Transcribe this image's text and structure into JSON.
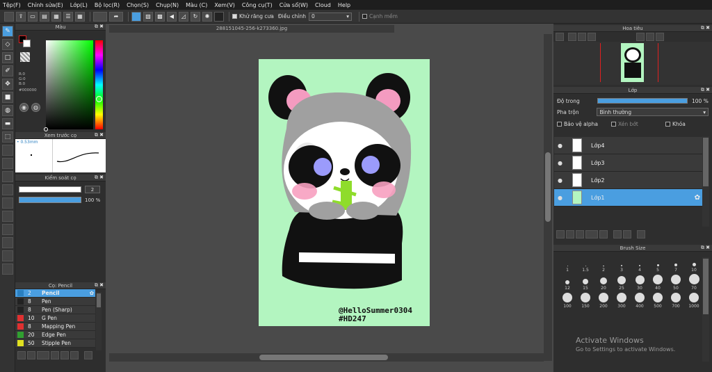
{
  "menu": [
    "Tệp(F)",
    "Chỉnh sửa(E)",
    "Lớp(L)",
    "Bộ lọc(R)",
    "Chọn(S)",
    "Chụp(N)",
    "Màu (C)",
    "Xem(V)",
    "Công cụ(T)",
    "Cửa sổ(W)",
    "Cloud",
    "Help"
  ],
  "toolbar": {
    "antialias_label": "Khử răng cưa",
    "correction_label": "Điều chỉnh",
    "correction_value": "0",
    "snap_label": "Cạnh mềm"
  },
  "color_panel": {
    "title": "Màu",
    "r": "R:0",
    "g": "G:0",
    "b": "B:0",
    "hex": "#000000",
    "fg_color": "#000000",
    "bg_color": "#ffffff"
  },
  "brush_preview": {
    "title": "Xem trước cọ",
    "size": "0.53mm"
  },
  "brush_control": {
    "title": "Kiểm soát cọ",
    "size_value": "2",
    "opacity_value": "100 %"
  },
  "brush_list": {
    "title": "Cọ: Pencil",
    "items": [
      {
        "size": "2",
        "name": "Pencil",
        "color": "#2a7fc0",
        "active": true
      },
      {
        "size": "8",
        "name": "Pen",
        "color": "#222222",
        "active": false
      },
      {
        "size": "8",
        "name": "Pen (Sharp)",
        "color": "#222222",
        "active": false
      },
      {
        "size": "10",
        "name": "G Pen",
        "color": "#e03030",
        "active": false
      },
      {
        "size": "8",
        "name": "Mapping Pen",
        "color": "#e03030",
        "active": false
      },
      {
        "size": "20",
        "name": "Edge Pen",
        "color": "#30a030",
        "active": false
      },
      {
        "size": "50",
        "name": "Stipple Pen",
        "color": "#e0e020",
        "active": false
      }
    ]
  },
  "document": {
    "filename": "288151045-256-k273360.jpg",
    "bg_color": "#b3f5c0",
    "signature": "@HelloSummer0304",
    "hashtag": "#HD247"
  },
  "navigator": {
    "title": "Hoa tiêu"
  },
  "layers": {
    "title": "Lớp",
    "opacity_label": "Độ trong",
    "opacity_value": "100 %",
    "blend_label": "Pha trộn",
    "blend_value": "Bình thường",
    "protect_alpha": "Bảo vệ alpha",
    "clipping": "Xén bớt",
    "lock": "Khóa",
    "items": [
      {
        "name": "Lớp4",
        "active": false
      },
      {
        "name": "Lớp3",
        "active": false
      },
      {
        "name": "Lớp2",
        "active": false
      },
      {
        "name": "Lớp1",
        "active": true
      }
    ]
  },
  "brush_size": {
    "title": "Brush Size",
    "sizes": [
      "1",
      "1.5",
      "2",
      "3",
      "4",
      "5",
      "7",
      "10",
      "12",
      "15",
      "20",
      "25",
      "30",
      "40",
      "50",
      "70",
      "100",
      "150",
      "200",
      "300",
      "400",
      "500",
      "700",
      "1000"
    ]
  },
  "watermark": {
    "line1": "Activate Windows",
    "line2": "Go to Settings to activate Windows."
  },
  "colors": {
    "accent": "#4a9ee0"
  }
}
